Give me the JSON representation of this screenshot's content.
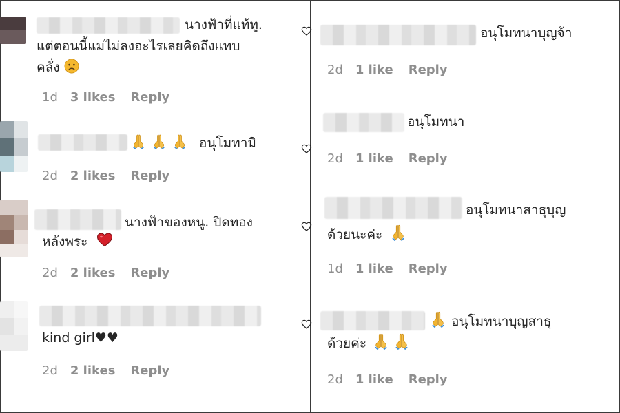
{
  "left_column": [
    {
      "text": "นางฟ้าที่แท้ทู.",
      "text2": "แต่ตอนนี้แม่ไม่ลงอะไรเลยคิดถึงแทบ",
      "text3": "คลั่ง",
      "emoji": "sad-face",
      "time": "1d",
      "likes": "3 likes",
      "reply": "Reply"
    },
    {
      "text": "อนุโมทามิ",
      "emoji": "folded-hands x3",
      "time": "2d",
      "likes": "2 likes",
      "reply": "Reply"
    },
    {
      "text": "นางฟ้าของหนู. ปิดทอง",
      "text2": "หลังพระ",
      "emoji": "red-heart",
      "time": "2d",
      "likes": "2 likes",
      "reply": "Reply"
    },
    {
      "text": "kind girl♥♥",
      "time": "2d",
      "likes": "2 likes",
      "reply": "Reply"
    }
  ],
  "right_column": [
    {
      "text": "อนุโมทนาบุญจ้า",
      "time": "2d",
      "likes": "1 like",
      "reply": "Reply"
    },
    {
      "text": "อนุโมทนา",
      "time": "2d",
      "likes": "1 like",
      "reply": "Reply"
    },
    {
      "text": "อนุโมทนาสาธุบุญ",
      "text2": "ด้วยนะค่ะ",
      "emoji": "folded-hands",
      "time": "1d",
      "likes": "1 like",
      "reply": "Reply"
    },
    {
      "text": "อนุโมทนาบุญสาธุ",
      "text2": "ด้วยค่ะ",
      "emoji": "folded-hands x3",
      "time": "2d",
      "likes": "1 like",
      "reply": "Reply"
    }
  ],
  "colors": {
    "text": "#262626",
    "meta": "#8e8e8e",
    "heart_red": "#d4202a",
    "hands": "#f2b531"
  }
}
